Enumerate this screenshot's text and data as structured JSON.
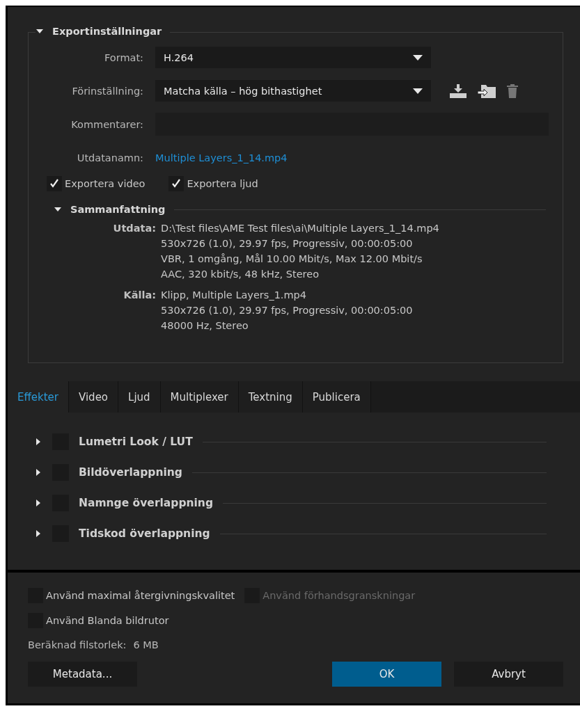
{
  "export_settings": {
    "title": "Exportinställningar",
    "expanded": true,
    "format": {
      "label": "Format:",
      "value": "H.264"
    },
    "preset": {
      "label": "Förinställning:",
      "value": "Matcha källa – hög bithastighet"
    },
    "comments": {
      "label": "Kommentarer:"
    },
    "output_name": {
      "label": "Utdatanamn:",
      "value": "Multiple Layers_1_14.mp4"
    },
    "checkboxes": [
      {
        "label": "Exportera video",
        "checked": true
      },
      {
        "label": "Exportera ljud",
        "checked": true
      }
    ],
    "summary": {
      "title": "Sammanfattning",
      "expanded": true,
      "entries": [
        {
          "label": "Utdata:",
          "lines": [
            "D:\\Test files\\AME Test files\\ai\\Multiple Layers_1_14.mp4",
            "530x726 (1.0), 29.97 fps, Progressiv, 00:00:05:00",
            "VBR, 1 omgång, Mål 10.00 Mbit/s, Max 12.00 Mbit/s",
            "AAC, 320 kbit/s, 48 kHz, Stereo"
          ]
        },
        {
          "label": "Källa:",
          "lines": [
            "Klipp, Multiple Layers_1.mp4",
            "530x726 (1.0), 29.97 fps, Progressiv, 00:00:05:00",
            "48000 Hz, Stereo"
          ]
        }
      ]
    }
  },
  "tabs": [
    {
      "label": "Effekter",
      "selected": true
    },
    {
      "label": "Video",
      "selected": false
    },
    {
      "label": "Ljud",
      "selected": false
    },
    {
      "label": "Multiplexer",
      "selected": false
    },
    {
      "label": "Textning",
      "selected": false
    },
    {
      "label": "Publicera",
      "selected": false
    }
  ],
  "effects": [
    {
      "label": "Lumetri Look / LUT",
      "expanded": false,
      "checked": false
    },
    {
      "label": "Bildöverlappning",
      "expanded": false,
      "checked": false
    },
    {
      "label": "Namnge överlappning",
      "expanded": false,
      "checked": false
    },
    {
      "label": "Tidskod överlappning",
      "expanded": false,
      "checked": false
    }
  ],
  "options": [
    {
      "label": "Använd maximal återgivningskvalitet",
      "checked": false,
      "disabled": false
    },
    {
      "label": "Använd förhandsgranskningar",
      "checked": false,
      "disabled": true
    },
    {
      "label": "Använd Blanda bildrutor",
      "checked": false,
      "disabled": false
    }
  ],
  "file_size": {
    "label": "Beräknad filstorlek:",
    "value": "6 MB"
  },
  "buttons": [
    {
      "label": "Metadata...",
      "kind": "secondary"
    },
    {
      "label": "OK",
      "kind": "primary"
    },
    {
      "label": "Avbryt",
      "kind": "secondary"
    }
  ]
}
